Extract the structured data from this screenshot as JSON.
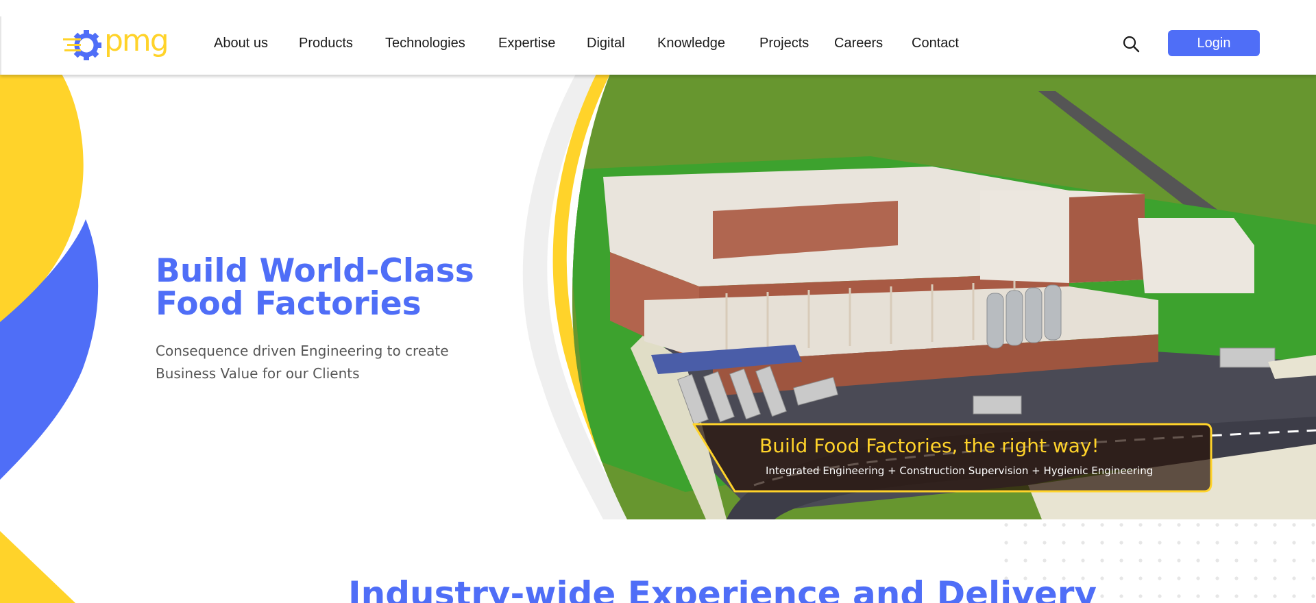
{
  "brand": {
    "logo_text": "pmg",
    "colors": {
      "primary": "#4f6ef7",
      "accent": "#ffd32a",
      "text": "#1a1a1a"
    }
  },
  "nav": {
    "items": [
      {
        "label": "About us"
      },
      {
        "label": "Products"
      },
      {
        "label": "Technologies"
      },
      {
        "label": "Expertise"
      },
      {
        "label": "Digital"
      },
      {
        "label": "Knowledge"
      },
      {
        "label": "Projects"
      },
      {
        "label": "Careers"
      },
      {
        "label": "Contact"
      }
    ],
    "search_icon": "search-icon",
    "login_label": "Login"
  },
  "hero": {
    "title_line1": "Build World-Class",
    "title_line2": "Food Factories",
    "subtitle_line1": "Consequence driven Engineering to create",
    "subtitle_line2": "Business Value for our Clients",
    "banner_title": "Build Food Factories, the right way!",
    "banner_subtitle": "Integrated Engineering + Construction Supervision + Hygienic Engineering"
  },
  "section": {
    "heading": "Industry-wide Experience and Delivery"
  }
}
